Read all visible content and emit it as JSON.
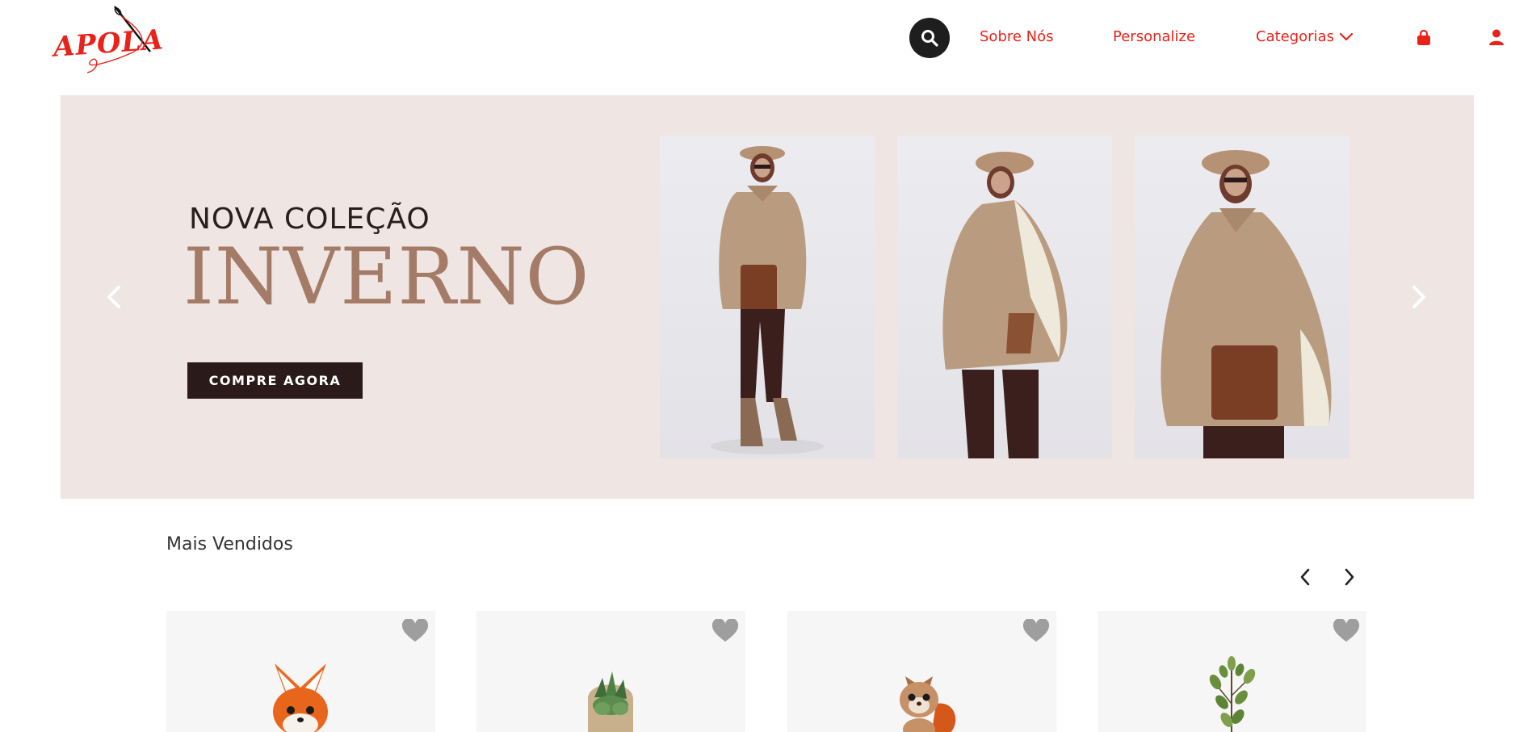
{
  "header": {
    "logo_text": "APOLA",
    "nav": {
      "about": "Sobre Nós",
      "customize": "Personalize",
      "categories": "Categorias"
    },
    "icons": {
      "search": "search-icon",
      "categories_caret": "chevron-down-icon",
      "cart": "shopping-bag-icon",
      "account": "user-icon"
    }
  },
  "hero": {
    "subtitle": "NOVA COLEÇÃO",
    "title": "INVERNO",
    "cta_label": "COMPRE AGORA",
    "photos": [
      "model-cape-photo-1",
      "model-cape-photo-2",
      "model-cape-photo-3"
    ]
  },
  "best_sellers": {
    "title": "Mais Vendidos",
    "products": [
      {
        "image": "crochet-fox-toy",
        "favorite_icon": "heart-icon"
      },
      {
        "image": "succulent-plant-pot",
        "favorite_icon": "heart-icon"
      },
      {
        "image": "crochet-squirrel-toy",
        "favorite_icon": "heart-icon"
      },
      {
        "image": "leafy-plant",
        "favorite_icon": "heart-icon"
      }
    ]
  },
  "colors": {
    "brand_red": "#e8231b",
    "hero_bg": "#efe5e3",
    "hero_title": "#a47b66",
    "cta_bg": "#2b1a1a",
    "card_bg": "#f6f6f6"
  }
}
